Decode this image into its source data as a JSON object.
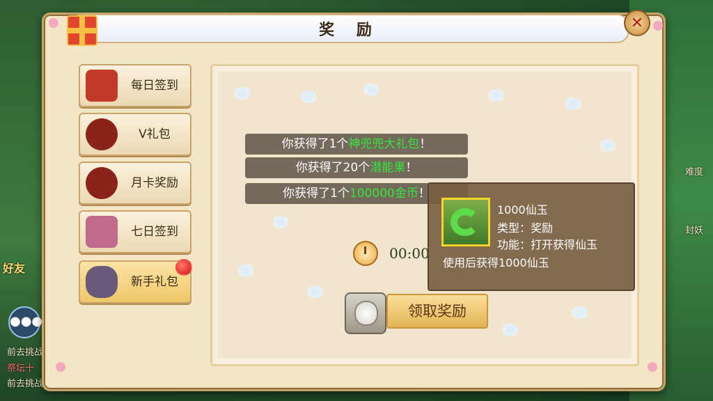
{
  "window": {
    "title": "奖 励",
    "close_glyph": "✕"
  },
  "tabs": [
    {
      "label": "每日签到",
      "icon": "scroll-envelope-icon",
      "color": "#c23b2a"
    },
    {
      "label": "V礼包",
      "icon": "basket-icon",
      "color": "#8a2418"
    },
    {
      "label": "月卡奖励",
      "icon": "basket-icon",
      "color": "#8a2418"
    },
    {
      "label": "七日签到",
      "icon": "scroll-icon",
      "color": "#c06a8e"
    },
    {
      "label": "新手礼包",
      "icon": "pouch-icon",
      "color": "#6a5a7a",
      "active": true,
      "badge": true
    }
  ],
  "messages": [
    {
      "prefix": "你获得了1个",
      "highlight": "神兜兜大礼包",
      "suffix": "！"
    },
    {
      "prefix": "你获得了20个",
      "highlight": "潜能果",
      "suffix": "！"
    },
    {
      "prefix": "你获得了1个",
      "highlight": "100000金币",
      "suffix": "！"
    }
  ],
  "timer": {
    "value": "00:00"
  },
  "claim_button": {
    "label": "领取奖励"
  },
  "tooltip": {
    "name": "1000仙玉",
    "type": "类型：奖励",
    "function": "功能：打开获得仙玉",
    "usage": "使用后获得1000仙玉"
  },
  "background": {
    "left_texts": [
      "前去挑战",
      "祭坛十",
      "前去挑战"
    ],
    "friends_label": "好友",
    "right_texts": [
      "难度",
      "封妖"
    ]
  },
  "colors": {
    "highlight": "#35e63c",
    "panel": "#f3e6c6",
    "accent_gold": "#e2b454"
  }
}
